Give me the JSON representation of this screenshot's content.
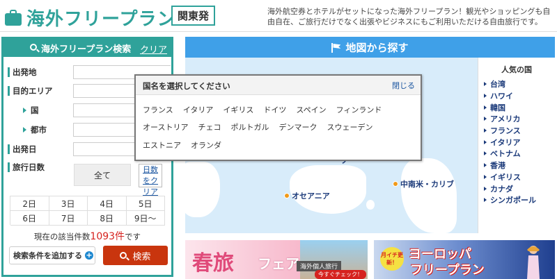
{
  "header": {
    "site_title": "海外フリープラン",
    "region_button": "関東発",
    "description": "海外航空券とホテルがセットになった海外フリープラン！観光やショッピングも自由自在、ご旅行だけでなく出張やビジネスにもご利用いただける自由旅行です。"
  },
  "search": {
    "title": "海外フリープラン検索",
    "clear": "クリア",
    "fields": {
      "departure": "出発地",
      "destination": "目的エリア",
      "country": "国",
      "city": "都市",
      "departure_date": "出発日",
      "duration": "旅行日数"
    },
    "all_button": "全て",
    "days_link": "日数をクリア",
    "days": [
      "2日",
      "3日",
      "4日",
      "5日",
      "6日",
      "7日",
      "8日",
      "9日〜"
    ],
    "count_prefix": "現在の該当件数",
    "count": "1093件",
    "count_suffix": "です",
    "add_condition": "検索条件を追加する",
    "search_button": "検索"
  },
  "map": {
    "title": "地図から探す",
    "labels": {
      "oceania": "オセアニア",
      "latin_america": "中南米・カリブ",
      "partial": "ーゾー"
    },
    "popular_title": "人気の国",
    "popular": [
      "台湾",
      "ハワイ",
      "韓国",
      "アメリカ",
      "フランス",
      "イタリア",
      "ベトナム",
      "香港",
      "イギリス",
      "カナダ",
      "シンガポール"
    ]
  },
  "popup": {
    "title": "国名を選択してください",
    "close": "閉じる",
    "countries": [
      "フランス",
      "イタリア",
      "イギリス",
      "ドイツ",
      "スペイン",
      "フィンランド",
      "オーストリア",
      "チェコ",
      "ポルトガル",
      "デンマーク",
      "スウェーデン",
      "エストニア",
      "オランダ"
    ]
  },
  "banners": {
    "spring": {
      "t1": "春旅",
      "t2": "フェア",
      "t3": "海外個人旅行",
      "t4": "今すぐチェック！"
    },
    "europe": {
      "badge": "月イチ更新！",
      "line1": "ヨーロッパ",
      "line2": "フリープラン"
    }
  }
}
